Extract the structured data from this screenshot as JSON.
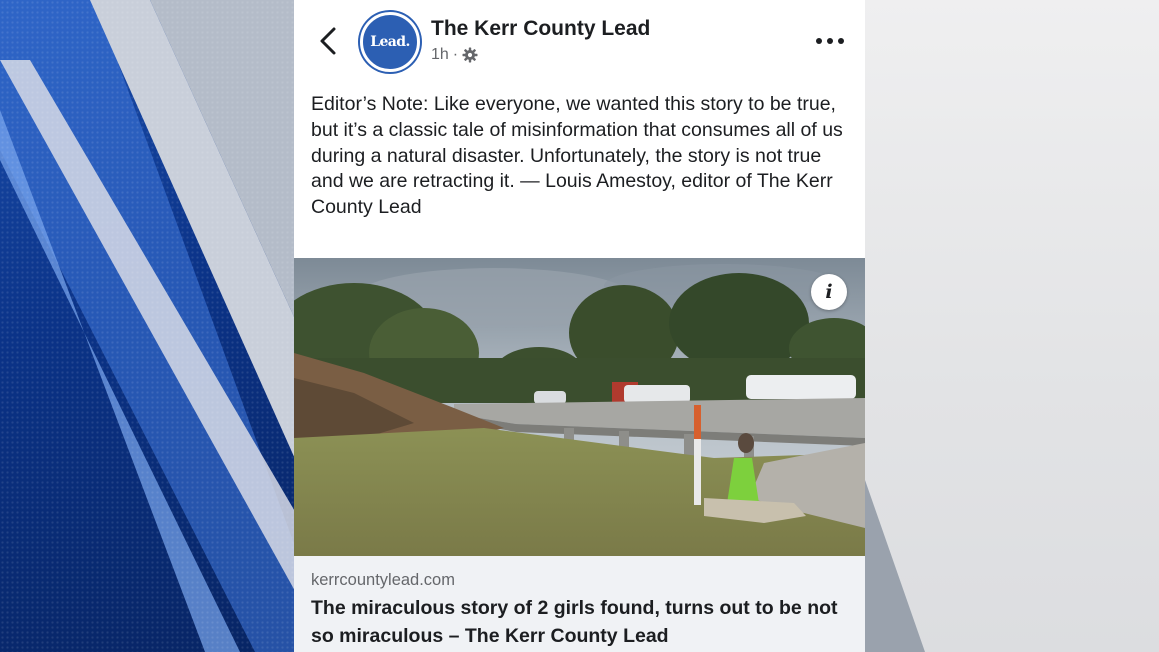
{
  "post": {
    "page_name": "The Kerr County Lead",
    "avatar_text": "Lead.",
    "time_ago": "1h",
    "separator": "·",
    "audience_icon": "gear-icon",
    "back_icon": "chevron-left-icon",
    "more_icon": "ellipsis-icon",
    "text": "Editor’s Note: Like everyone, we wanted this story to be true, but it’s a classic tale of misinformation that consumes all of us during a natural disaster. Unfortunately, the story is not true and we are retracting it. — Louis Amestoy, editor of The Kerr County Lead",
    "info_label": "i"
  },
  "link_preview": {
    "domain": "kerrcountylead.com",
    "title": "The miraculous story of 2 girls found, turns out to be not so miraculous – The Kerr County Lead"
  },
  "colors": {
    "brand_blue": "#2c5fb3",
    "broadcast_blue": "#0b3388",
    "text_primary": "#1c1e21",
    "text_secondary": "#65676b",
    "link_bg": "#f0f2f5"
  }
}
